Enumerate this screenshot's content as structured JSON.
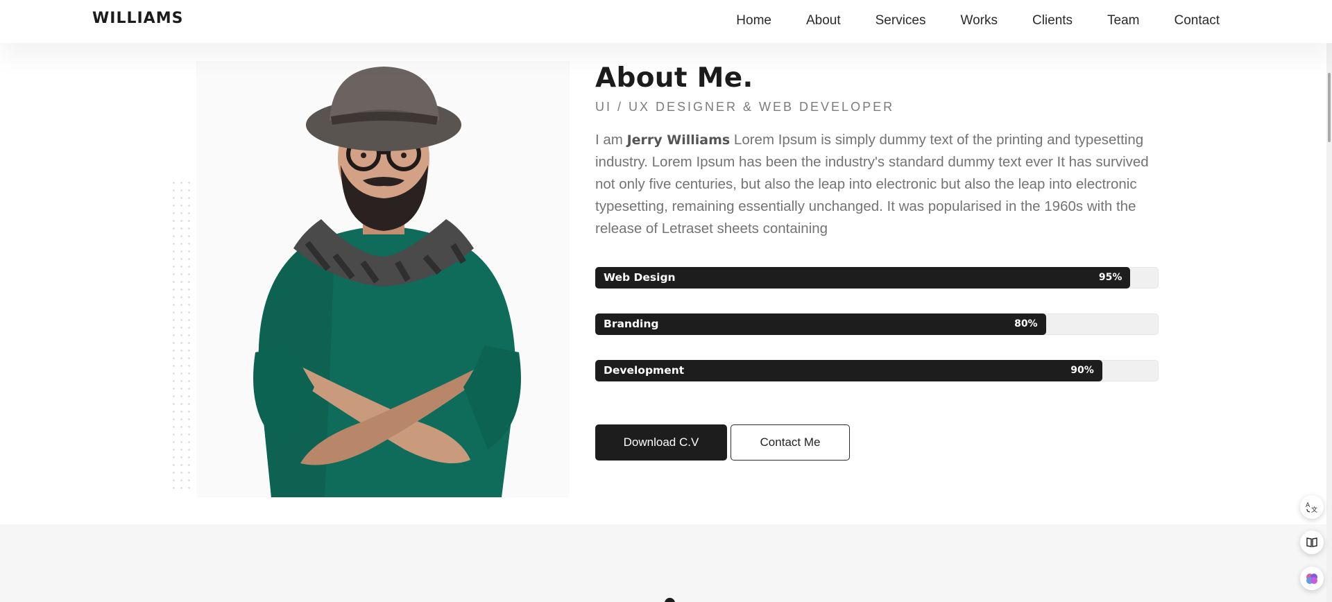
{
  "header": {
    "brand": "WILLIAMS",
    "nav": [
      "Home",
      "About",
      "Services",
      "Works",
      "Clients",
      "Team",
      "Contact"
    ]
  },
  "about": {
    "title": "About Me.",
    "subtitle": "UI / UX DESIGNER & WEB DEVELOPER",
    "intro_prefix": "I am ",
    "name": "Jerry Williams",
    "intro_text": " Lorem Ipsum is simply dummy text of the printing and typesetting industry. Lorem Ipsum has been the industry's standard dummy text ever It has survived not only five centuries, but also the leap into electronic but also the leap into electronic typesetting, remaining essentially unchanged. It was popularised in the 1960s with the release of Letraset sheets containing",
    "skills": [
      {
        "label": "Web Design",
        "percent_text": "95%",
        "level": 95
      },
      {
        "label": "Branding",
        "percent_text": "80%",
        "level": 80
      },
      {
        "label": "Development",
        "percent_text": "90%",
        "level": 90
      }
    ],
    "buttons": {
      "download": "Download C.V",
      "contact": "Contact Me"
    }
  },
  "side_icons": [
    "translate-icon",
    "book-icon",
    "brain-icon"
  ],
  "colors": {
    "accent": "#1d1d1d",
    "text_muted": "#737373",
    "bar_track": "#f0f0f0",
    "sweater": "#0f6b5a"
  }
}
